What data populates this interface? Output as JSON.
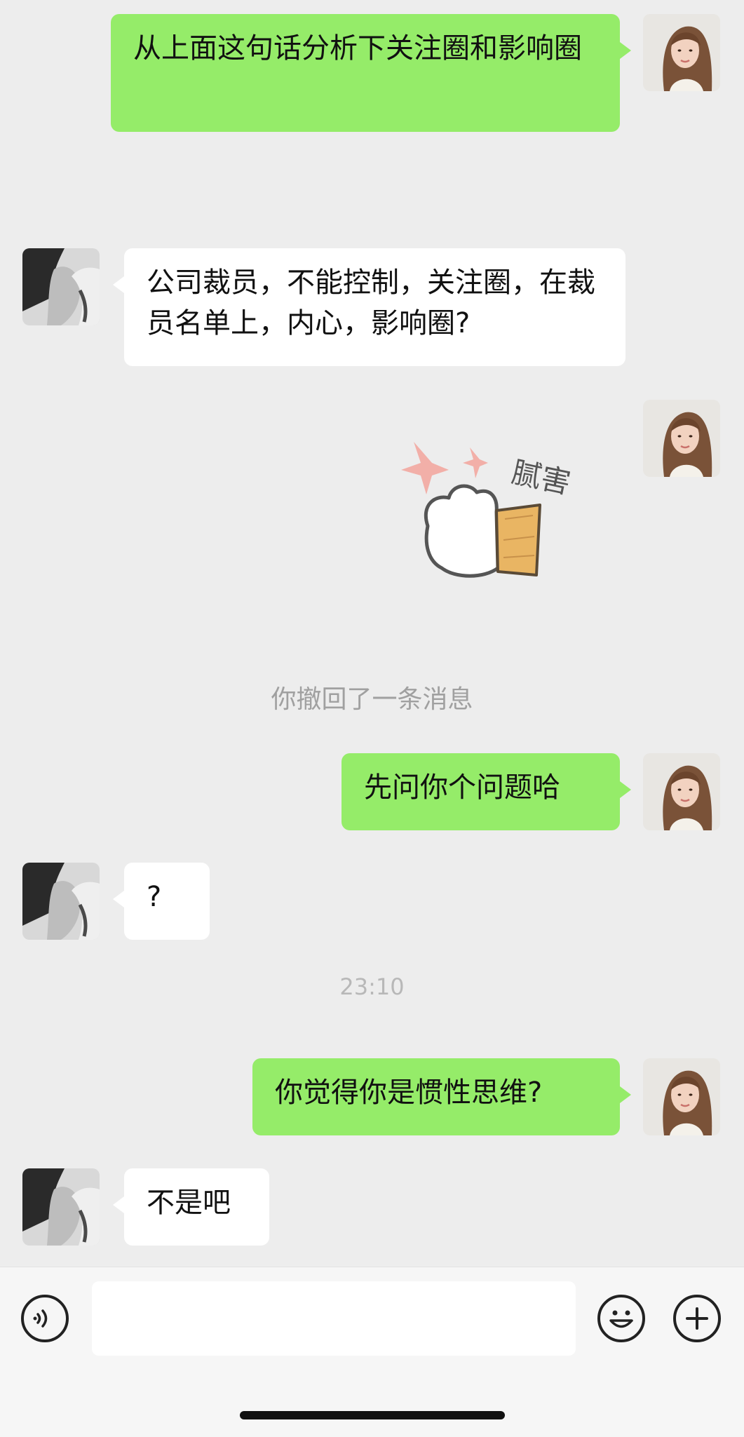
{
  "messages": {
    "m1": "从上面这句话分析下关注圈和影响圈",
    "m2": "公司裁员，不能控制，关注圈，在裁员名单上，内心，影响圈?",
    "sticker_text": "腻害",
    "m4": "先问你个问题哈",
    "m5": "?",
    "m6": "你觉得你是惯性思维?",
    "m7": "不是吧"
  },
  "system": {
    "recalled": "你撤回了一条消息",
    "timestamp": "23:10"
  },
  "input": {
    "placeholder": "",
    "value": ""
  },
  "icons": {
    "voice": "voice-icon",
    "emoji": "emoji-icon",
    "plus": "plus-icon"
  },
  "colors": {
    "my_bubble": "#95ec69",
    "their_bubble": "#ffffff",
    "background": "#ededed"
  }
}
